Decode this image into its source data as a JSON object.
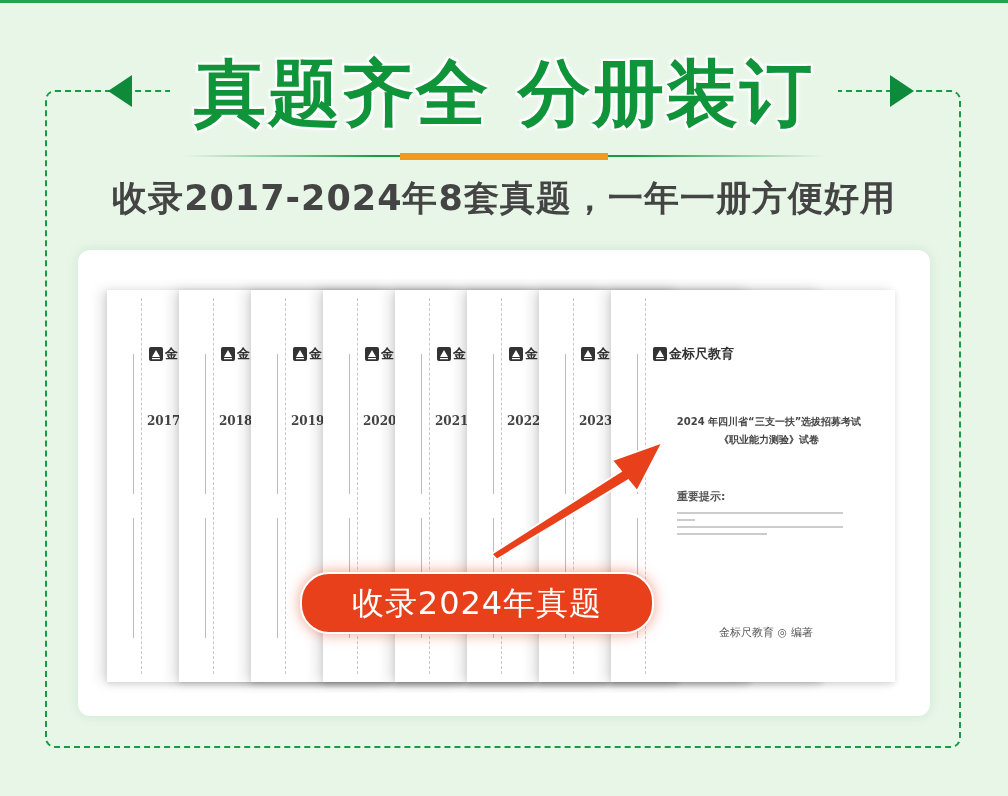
{
  "headline": "真题齐全 分册装订",
  "subtitle": "收录2017-2024年8套真题，一年一册方便好用",
  "papers": [
    {
      "year": "2017",
      "logo": "金"
    },
    {
      "year": "2018",
      "logo": "金"
    },
    {
      "year": "2019",
      "logo": "金"
    },
    {
      "year": "2020",
      "logo": "金"
    },
    {
      "year": "2021",
      "logo": "金"
    },
    {
      "year": "2022",
      "logo": "金"
    },
    {
      "year": "2023",
      "logo": "金"
    }
  ],
  "front_paper": {
    "logo": "金标尺教育",
    "title_lines": [
      "2024 年四川省“三支一扶”选拔招募考试",
      "《职业能力测验》试卷"
    ],
    "notice_heading": "重要提示:",
    "footer": "金标尺教育 ◎ 编著"
  },
  "callout": "收录2024年真题"
}
